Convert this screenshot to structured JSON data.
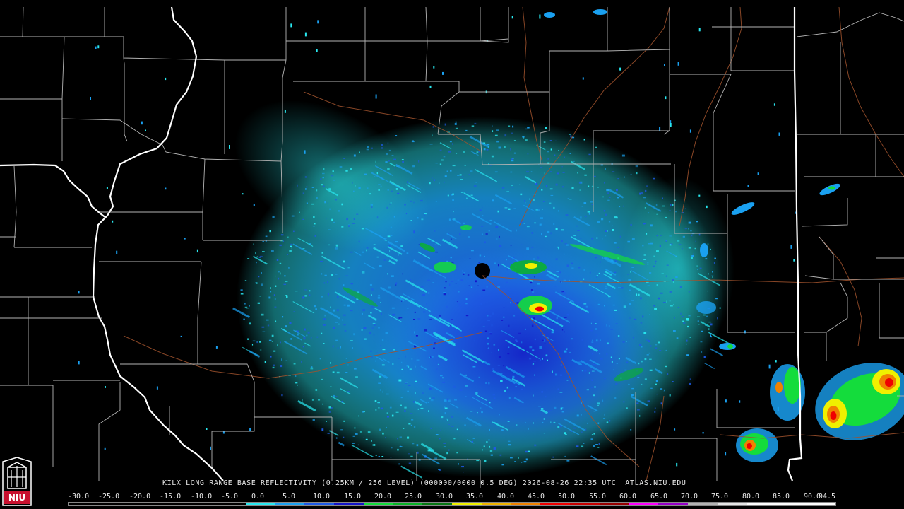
{
  "product": {
    "caption": "KILX LONG RANGE BASE REFLECTIVITY (0.25KM / 256 LEVEL) (000000/0000 0.5 DEG) 2026-08-26 22:35 UTC  ATLAS.NIU.EDU"
  },
  "legend": {
    "labels": [
      "-30.0",
      "-25.0",
      "-20.0",
      "-15.0",
      "-10.0",
      "-5.0",
      "0.0",
      "5.0",
      "10.0",
      "15.0",
      "20.0",
      "25.0",
      "30.0",
      "35.0",
      "40.0",
      "45.0",
      "50.0",
      "55.0",
      "60.0",
      "65.0",
      "70.0",
      "75.0",
      "80.0",
      "85.0",
      "90.0",
      "94.5"
    ],
    "colors": [
      "#000000",
      "#000000",
      "#000000",
      "#000000",
      "#000000",
      "#000000",
      "#29e8f0",
      "#1aa0f0",
      "#1e5ae6",
      "#1414c8",
      "#14dc3c",
      "#0ab428",
      "#087814",
      "#f0f000",
      "#f0b400",
      "#f08200",
      "#f00000",
      "#c80000",
      "#960000",
      "#ff00ff",
      "#9600c8",
      "#b4b4b4",
      "#e6e6e6",
      "#ffffff",
      "#ffffff",
      "#ffffff"
    ]
  },
  "logo": {
    "text": "NIU"
  },
  "map": {
    "radar_site": "KILX",
    "echo_colors": {
      "light_cyan": "#29e8f0",
      "blue": "#1aa0f0",
      "mid_blue": "#1e5ae6",
      "dark_blue": "#1414c8",
      "green": "#14dc3c",
      "dark_green": "#0ab428",
      "yellow": "#f0f000",
      "orange": "#f08200",
      "red": "#f00000"
    }
  }
}
